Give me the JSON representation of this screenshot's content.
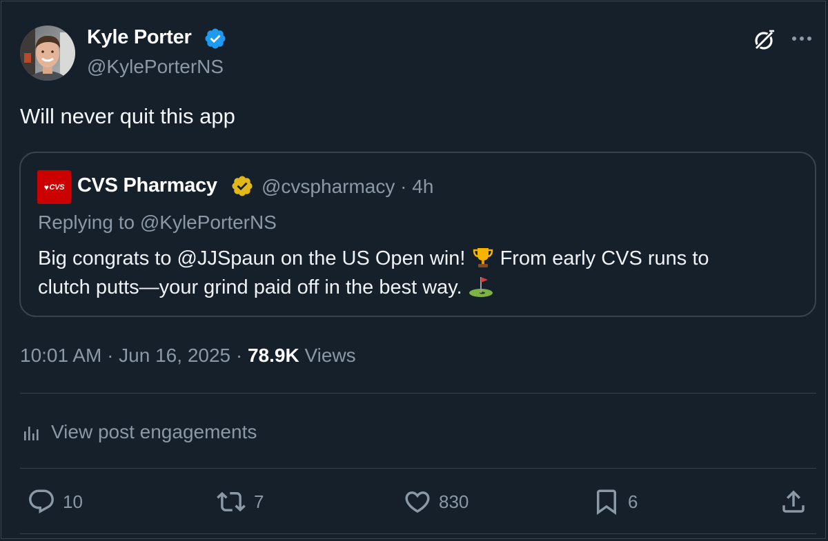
{
  "post": {
    "author_name": "Kyle Porter",
    "author_handle": "@KylePorterNS",
    "text": "Will never quit this app",
    "timestamp": "10:01 AM · Jun 16, 2025 · ",
    "views_count": "78.9K",
    "views_label": "Views",
    "engagements_label": "View post engagements"
  },
  "quote": {
    "logo_text": "CVS",
    "author_name": "CVS Pharmacy",
    "meta": "@cvspharmacy · 4h",
    "replying_to": "Replying to @KylePorterNS",
    "line1": "Big congrats to @JJSpaun on the US Open win! ",
    "line1_after": " From early CVS runs to",
    "line2": "clutch putts—your grind paid off in the best way. "
  },
  "actions": {
    "replies": "10",
    "reposts": "7",
    "likes": "830",
    "bookmarks": "6"
  },
  "colors": {
    "background": "#15202b",
    "muted_text": "#8b98a5",
    "verified_blue": "#1d9bf0",
    "verified_gold": "#e2b719",
    "cvs_red": "#cc0000"
  }
}
